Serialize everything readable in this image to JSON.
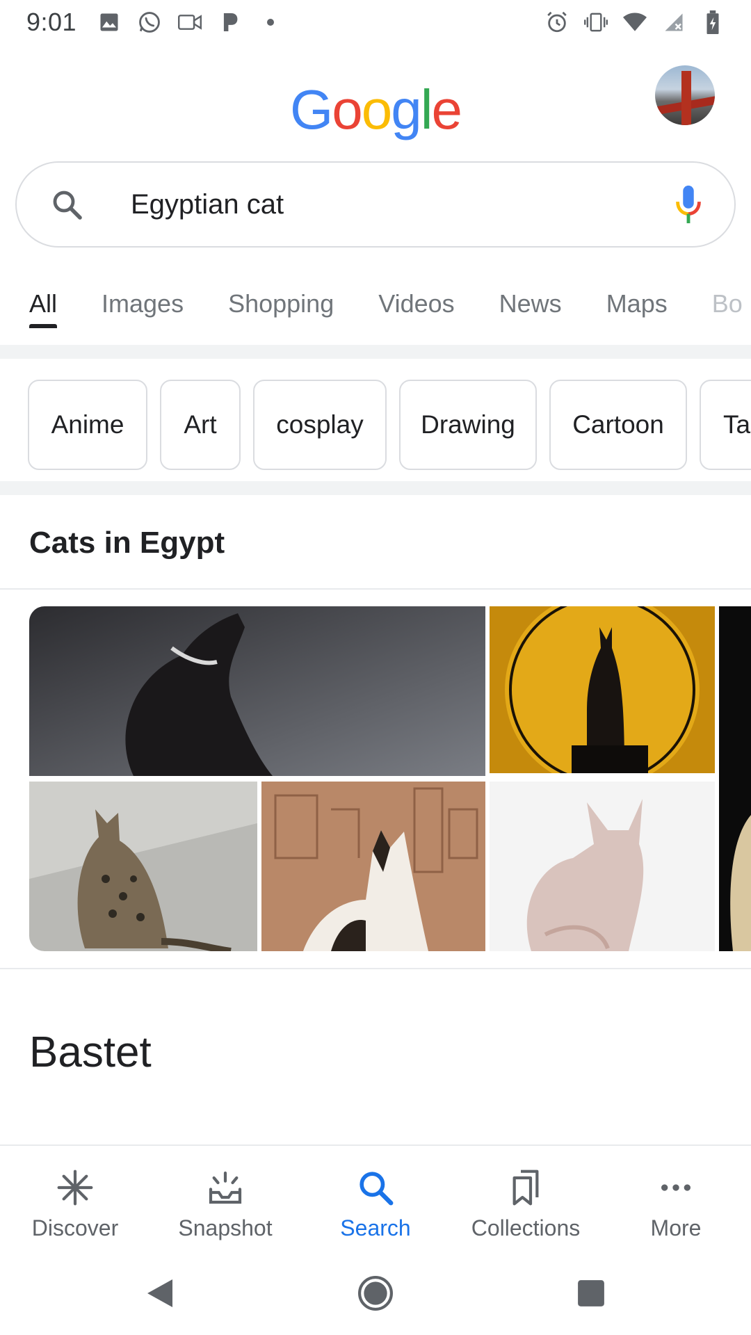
{
  "status_bar": {
    "time": "9:01",
    "left_icons": [
      "image-notification-icon",
      "whatsapp-icon",
      "video-call-icon",
      "pandora-icon",
      "dot-icon"
    ],
    "right_icons": [
      "alarm-icon",
      "vibrate-icon",
      "wifi-icon",
      "signal-icon",
      "battery-icon"
    ]
  },
  "header": {
    "logo_letters": [
      {
        "char": "G",
        "color": "#4285F4"
      },
      {
        "char": "o",
        "color": "#EA4335"
      },
      {
        "char": "o",
        "color": "#FBBC05"
      },
      {
        "char": "g",
        "color": "#4285F4"
      },
      {
        "char": "l",
        "color": "#34A853"
      },
      {
        "char": "e",
        "color": "#EA4335"
      }
    ]
  },
  "search": {
    "query": "Egyptian cat",
    "icon": "search-icon",
    "mic_icon": "mic-icon"
  },
  "tabs": [
    {
      "label": "All",
      "active": true
    },
    {
      "label": "Images",
      "active": false
    },
    {
      "label": "Shopping",
      "active": false
    },
    {
      "label": "Videos",
      "active": false
    },
    {
      "label": "News",
      "active": false
    },
    {
      "label": "Maps",
      "active": false
    },
    {
      "label": "Bo",
      "active": false
    }
  ],
  "chips": [
    "Anime",
    "Art",
    "cosplay",
    "Drawing",
    "Cartoon",
    "Ta"
  ],
  "section": {
    "title": "Cats in Egypt",
    "images": [
      "black-sphynx-cat",
      "bastet-statue",
      "egyptian-mau",
      "calico-cat-hieroglyphs",
      "pink-sphynx-cat",
      "partial-image"
    ]
  },
  "next_title": "Bastet",
  "bottom_nav": [
    {
      "label": "Discover",
      "icon": "asterisk-icon",
      "active": false
    },
    {
      "label": "Snapshot",
      "icon": "snapshot-icon",
      "active": false
    },
    {
      "label": "Search",
      "icon": "search-icon",
      "active": true
    },
    {
      "label": "Collections",
      "icon": "collections-icon",
      "active": false
    },
    {
      "label": "More",
      "icon": "more-dots-icon",
      "active": false
    }
  ],
  "system_nav": [
    "back-icon",
    "home-icon",
    "recents-icon"
  ],
  "colors": {
    "accent": "#1a73e8",
    "text": "#202124",
    "muted": "#70757a",
    "border": "#dadce0"
  }
}
